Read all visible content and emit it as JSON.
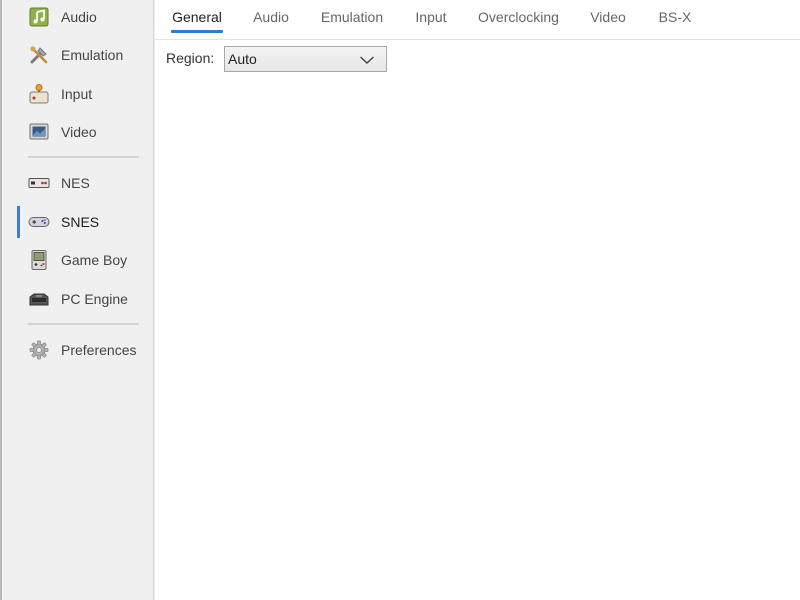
{
  "sidebar": {
    "items": [
      {
        "label": "Audio",
        "icon": "music-note-icon"
      },
      {
        "label": "Emulation",
        "icon": "tools-icon"
      },
      {
        "label": "Input",
        "icon": "joystick-icon"
      },
      {
        "label": "Video",
        "icon": "monitor-icon"
      },
      {
        "label": "NES",
        "icon": "nes-controller-icon"
      },
      {
        "label": "SNES",
        "icon": "snes-controller-icon"
      },
      {
        "label": "Game Boy",
        "icon": "gameboy-icon"
      },
      {
        "label": "PC Engine",
        "icon": "pc-engine-icon"
      },
      {
        "label": "Preferences",
        "icon": "gear-icon"
      }
    ],
    "selected": "SNES"
  },
  "tabs": [
    {
      "label": "General"
    },
    {
      "label": "Audio"
    },
    {
      "label": "Emulation"
    },
    {
      "label": "Input"
    },
    {
      "label": "Overclocking"
    },
    {
      "label": "Video"
    },
    {
      "label": "BS-X"
    }
  ],
  "active_tab": "General",
  "general": {
    "region_label": "Region:",
    "region_value": "Auto"
  },
  "colors": {
    "accent": "#2f7cc8",
    "sidebar_bg": "#f0f0f0",
    "content_bg": "#ffffff"
  }
}
